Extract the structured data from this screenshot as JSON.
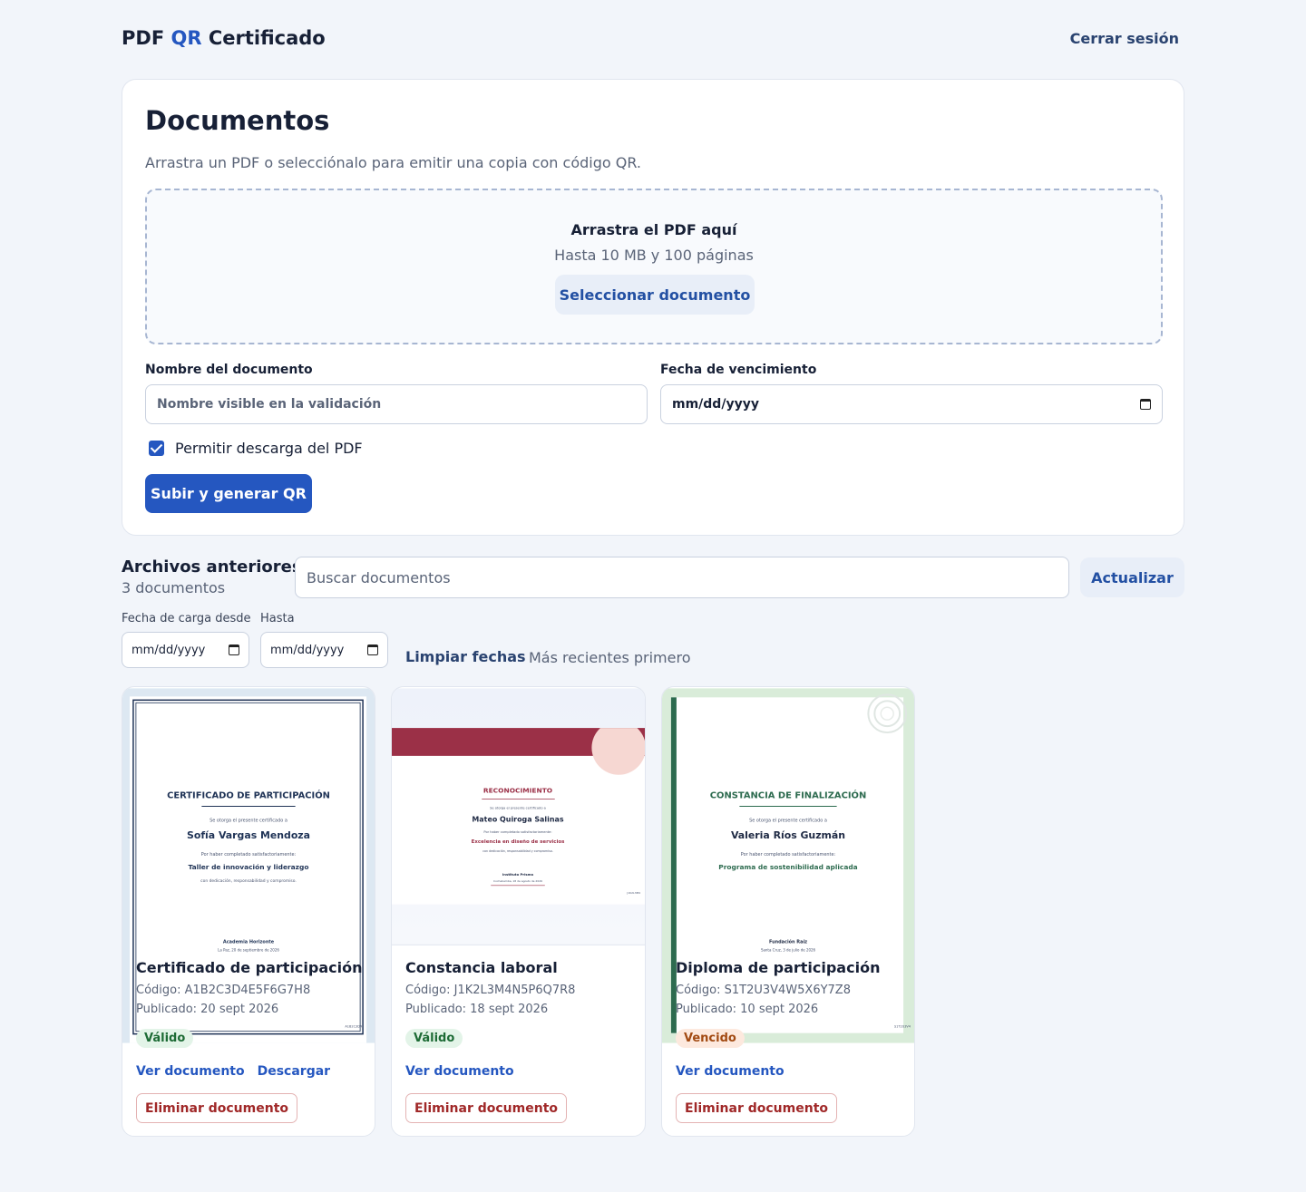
{
  "header": {
    "brand_prefix": "PDF",
    "brand_qr": "QR",
    "brand_suffix": "Certificado",
    "logout": "Cerrar sesión"
  },
  "upload": {
    "title": "Documentos",
    "subtitle": "Arrastra un PDF o selecciónalo para emitir una copia con código QR.",
    "dropzone_title": "Arrastra el PDF aquí",
    "dropzone_hint": "Hasta 10 MB y 100 páginas",
    "select_button": "Seleccionar documento",
    "name_label": "Nombre del documento",
    "name_placeholder": "Nombre visible en la validación",
    "expiry_label": "Fecha de vencimiento",
    "expiry_value": "mm/dd/yyyy",
    "allow_download_label": "Permitir descarga del PDF",
    "allow_download_checked": true,
    "submit_button": "Subir y generar QR"
  },
  "archive": {
    "title": "Archivos anteriores",
    "count": "3 documentos",
    "search_placeholder": "Buscar documentos",
    "refresh_button": "Actualizar",
    "from_label": "Fecha de carga desde",
    "from_value": "mm/dd/yyyy",
    "to_label": "Hasta",
    "to_value": "mm/dd/yyyy",
    "clear_dates": "Limpiar fechas",
    "sort_text": "Más recientes primero"
  },
  "documents": [
    {
      "title": "Certificado de participación",
      "code": "Código: A1B2C3D4E5F6G7H8",
      "published": "Publicado: 20 sept 2026",
      "status": "Válido",
      "view": "Ver documento",
      "download": "Descargar",
      "delete": "Eliminar documento",
      "preview": {
        "heading": "CERTIFICADO DE PARTICIPACIÓN",
        "granted": "Se otorga el presente certificado a",
        "recipient": "Sofía Vargas Mendoza",
        "reason": "Por haber completado satisfactoriamente:",
        "course": "Taller de innovación y liderazgo",
        "note": "con dedicación, responsabilidad y compromiso.",
        "issuer": "Academia Horizonte",
        "place_date": "La Paz, 20 de septiembre de 2026",
        "code_mark": "A1B2C3D4"
      }
    },
    {
      "title": "Constancia laboral",
      "code": "Código: J1K2L3M4N5P6Q7R8",
      "published": "Publicado: 18 sept 2026",
      "status": "Válido",
      "view": "Ver documento",
      "delete": "Eliminar documento",
      "preview": {
        "heading": "RECONOCIMIENTO",
        "granted": "Se otorga el presente certificado a",
        "recipient": "Mateo Quiroga Salinas",
        "reason": "Por haber completado satisfactoriamente:",
        "course": "Excelencia en diseño de servicios",
        "note": "con dedicación, responsabilidad y compromiso.",
        "issuer": "Instituto Prisma",
        "place_date": "Cochabamba, 18 de agosto de 2026",
        "code_mark": "J1K2L3M4"
      }
    },
    {
      "title": "Diploma de participación",
      "code": "Código: S1T2U3V4W5X6Y7Z8",
      "published": "Publicado: 10 sept 2026",
      "status": "Vencido",
      "view": "Ver documento",
      "delete": "Eliminar documento",
      "preview": {
        "heading": "CONSTANCIA DE FINALIZACIÓN",
        "granted": "Se otorga el presente certificado a",
        "recipient": "Valeria Ríos Guzmán",
        "reason": "Por haber completado satisfactoriamente:",
        "course": "Programa de sostenibilidad aplicada",
        "issuer": "Fundación Raíz",
        "place_date": "Santa Cruz, 3 de julio de 2026",
        "code_mark": "S1T2U3V4"
      }
    }
  ],
  "colors": {
    "accent": "#2557c0",
    "valid_badge": "#e3f4e8",
    "expired_badge": "#fde9de",
    "delete": "#a02828",
    "cert_navy": "#1f3356",
    "cert_red": "#9b3047",
    "cert_green": "#2d6b4f"
  }
}
